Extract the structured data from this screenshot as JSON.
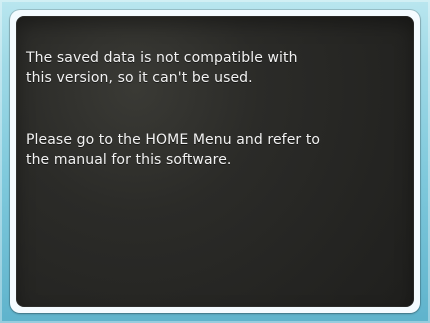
{
  "dialog": {
    "paragraph_1": "The saved data is not compatible with\nthis version, so it can't be used.",
    "paragraph_2": "Please go to the HOME Menu and refer to\nthe manual for this software."
  },
  "colors": {
    "background_top": "#b9e6ef",
    "background_bottom": "#5fb3cc",
    "frame": "#f4fbff",
    "panel": "#2b2b28",
    "text": "#f2f2f2"
  }
}
